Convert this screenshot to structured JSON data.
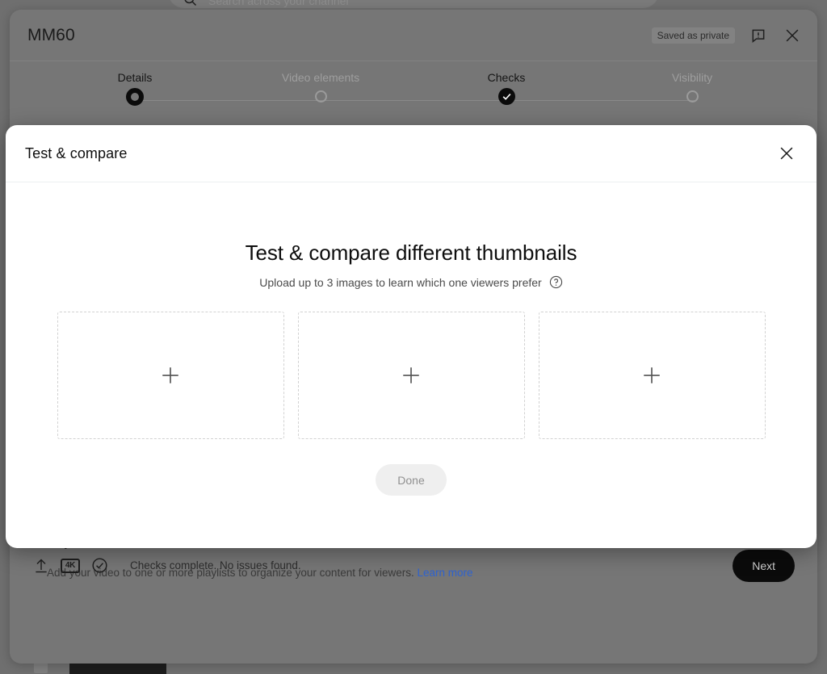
{
  "background": {
    "search": {
      "placeholder": "Search across your channel",
      "icon": "search-icon"
    }
  },
  "upload_dialog": {
    "title": "MM60",
    "saved_status": "Saved as private",
    "feedback_icon": "feedback-icon",
    "close_icon": "close-icon",
    "steps": [
      {
        "label": "Details",
        "state": "active"
      },
      {
        "label": "Video elements",
        "state": "inactive"
      },
      {
        "label": "Checks",
        "state": "done"
      },
      {
        "label": "Visibility",
        "state": "inactive"
      }
    ],
    "playlists": {
      "title": "Playlists",
      "description": "Add your video to one or more playlists to organize your content for viewers.",
      "learn_more": "Learn more"
    },
    "footer": {
      "upload_icon": "upload-icon",
      "resolution_badge": "4K",
      "check_icon": "check-circle-icon",
      "status": "Checks complete. No issues found.",
      "next_label": "Next"
    }
  },
  "modal": {
    "title": "Test & compare",
    "close_icon": "close-icon",
    "heading": "Test & compare different thumbnails",
    "subtitle": "Upload up to 3 images to learn which one viewers prefer",
    "help_icon": "help-circle-icon",
    "slots": [
      {
        "label": "",
        "icon": "plus-icon"
      },
      {
        "label": "",
        "icon": "plus-icon"
      },
      {
        "label": "",
        "icon": "plus-icon"
      }
    ],
    "done_label": "Done"
  },
  "colors": {
    "accent_link": "#2f63d0",
    "modal_bg": "#ffffff",
    "scrim": "#6e6e6e",
    "button_dark": "#0b0b0b"
  }
}
